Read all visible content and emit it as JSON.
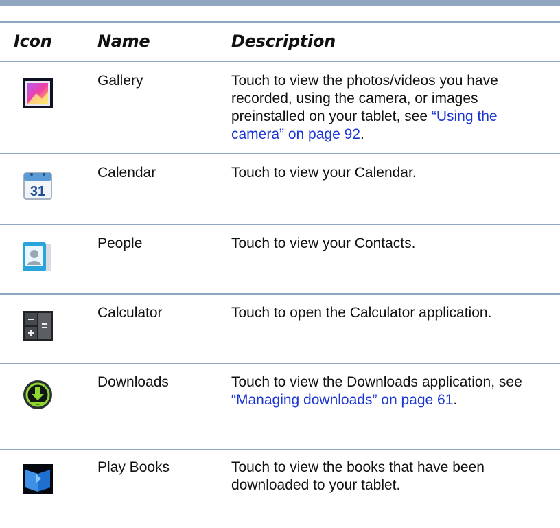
{
  "table": {
    "headers": {
      "icon": "Icon",
      "name": "Name",
      "description": "Description"
    },
    "rows": [
      {
        "name": "Gallery",
        "icon": "gallery-icon",
        "desc_pre": "Touch to view the photos/videos you have recorded, using the camera, or images preinstalled on your tablet, see ",
        "link": "“Using the camera” on page 92",
        "desc_post": "."
      },
      {
        "name": "Calendar",
        "icon": "calendar-icon",
        "icon_text": "31",
        "desc_pre": "Touch to view your Calendar.",
        "link": "",
        "desc_post": ""
      },
      {
        "name": "People",
        "icon": "people-icon",
        "desc_pre": "Touch to view your Contacts.",
        "link": "",
        "desc_post": ""
      },
      {
        "name": "Calculator",
        "icon": "calculator-icon",
        "desc_pre": "Touch to open the Calculator application.",
        "link": "",
        "desc_post": ""
      },
      {
        "name": "Downloads",
        "icon": "downloads-icon",
        "desc_pre": "Touch to view the Downloads application, see ",
        "link": "“Managing downloads” on page 61",
        "desc_post": "."
      },
      {
        "name": "Play Books",
        "icon": "play-books-icon",
        "desc_pre": "Touch to view the books that have been downloaded to your tablet.",
        "link": "",
        "desc_post": ""
      }
    ]
  },
  "colors": {
    "rule": "#8ea6bf",
    "link": "#1a35d4"
  }
}
